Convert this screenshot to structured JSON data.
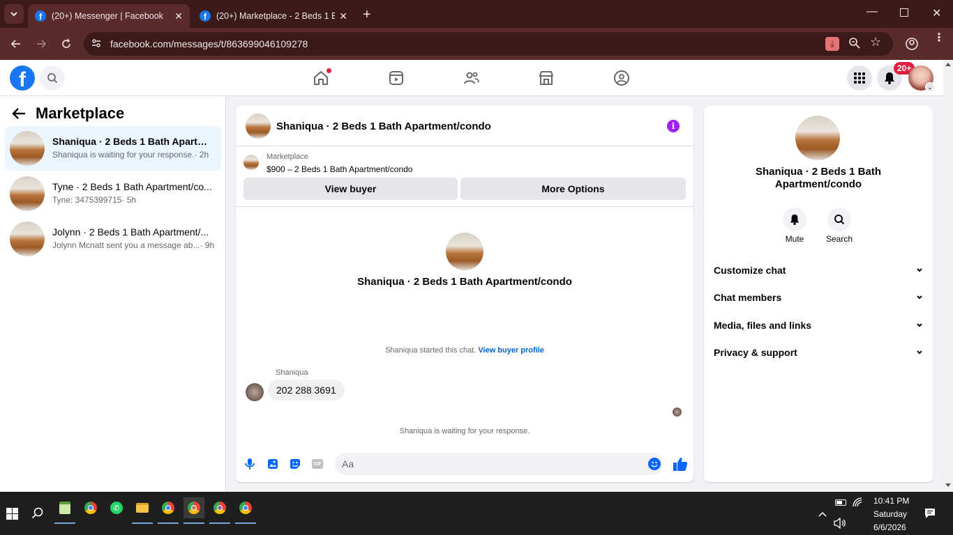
{
  "browser": {
    "tabs": [
      {
        "title": "(20+) Messenger | Facebook",
        "active": true
      },
      {
        "title": "(20+) Marketplace - 2 Beds 1 Ba",
        "active": false
      }
    ],
    "url": "facebook.com/messages/t/863699046109278"
  },
  "fb_header": {
    "notification_badge": "20+",
    "nav_items": [
      "home-icon",
      "video-icon",
      "friends-icon",
      "marketplace-icon",
      "groups-icon"
    ]
  },
  "left_panel": {
    "title": "Marketplace",
    "conversations": [
      {
        "name": "Shaniqua · 2 Beds 1 Bath Apartme...",
        "preview": "Shaniqua is waiting for your response.",
        "time": "· 2h"
      },
      {
        "name": "Tyne · 2 Beds 1 Bath Apartment/co...",
        "preview": "Tyne: 3475399715",
        "time": "· 5h"
      },
      {
        "name": "Jolynn · 2 Beds 1 Bath Apartment/...",
        "preview": "Jolynn Mcnatt sent you a message ab...",
        "time": "· 9h"
      }
    ]
  },
  "chat": {
    "header_title": "Shaniqua · 2 Beds 1 Bath Apartment/condo",
    "listing_label": "Marketplace",
    "listing_title": "$900 – 2 Beds 1 Bath Apartment/condo",
    "view_buyer": "View buyer",
    "more_options": "More Options",
    "intro_name": "Shaniqua · 2 Beds 1 Bath Apartment/condo",
    "started_text": "Shaniqua started this chat.",
    "view_profile": "View buyer profile",
    "sender": "Shaniqua",
    "message": "202 288 3691",
    "waiting": "Shaniqua is waiting for your response.",
    "input_placeholder": "Aa"
  },
  "right_panel": {
    "name": "Shaniqua · 2 Beds 1 Bath Apartment/condo",
    "mute": "Mute",
    "search": "Search",
    "sections": [
      "Customize chat",
      "Chat members",
      "Media, files and links",
      "Privacy & support"
    ]
  },
  "taskbar": {
    "time": "10:41 PM",
    "day": "Saturday",
    "date": "6/6/2026"
  },
  "colors": {
    "fb_blue": "#1877f2",
    "chrome_dark": "#3c1a1a",
    "chrome_bar": "#5b2a2a",
    "badge_red": "#e41e3f",
    "info_purple": "#a020f0"
  }
}
